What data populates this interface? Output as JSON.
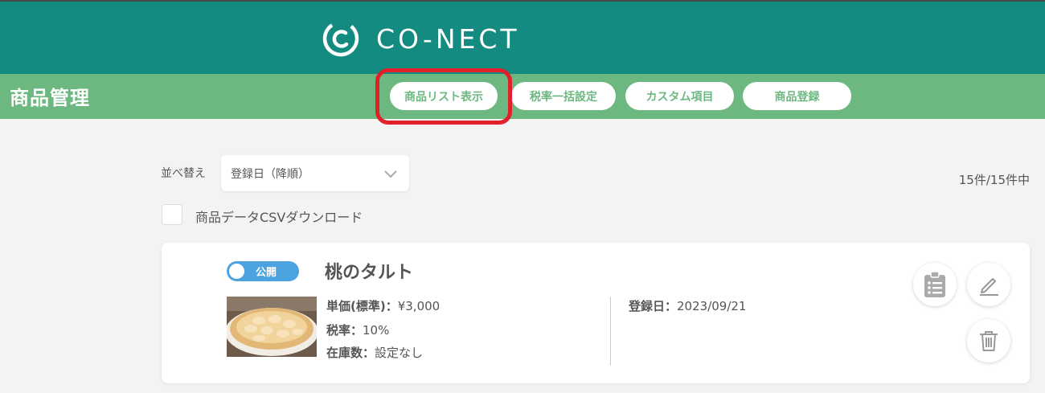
{
  "brand": {
    "name": "CO-NECT"
  },
  "colors": {
    "header": "#138b80",
    "subheader": "#6db881",
    "highlight": "#e0212a",
    "toggle": "#4da3e0"
  },
  "page": {
    "title": "商品管理"
  },
  "tabs": [
    {
      "label": "商品リスト表示",
      "active": true
    },
    {
      "label": "税率一括設定"
    },
    {
      "label": "カスタム項目"
    },
    {
      "label": "商品登録"
    }
  ],
  "sort": {
    "label": "並べ替え",
    "selected": "登録日（降順）"
  },
  "count": "15件/15件中",
  "csv": {
    "label": "商品データCSVダウンロード",
    "checked": false
  },
  "products": [
    {
      "status": "公開",
      "status_on": true,
      "name": "桃のタルト",
      "price_label": "単価(標準)：",
      "price": "¥3,000",
      "tax_label": "税率：",
      "tax": "10%",
      "stock_label": "在庫数：",
      "stock": "設定なし",
      "date_label": "登録日：",
      "date": "2023/09/21"
    }
  ],
  "icons": [
    "conect-logo-icon",
    "chevron-down-icon",
    "clipboard-icon",
    "edit-icon",
    "trash-icon"
  ]
}
